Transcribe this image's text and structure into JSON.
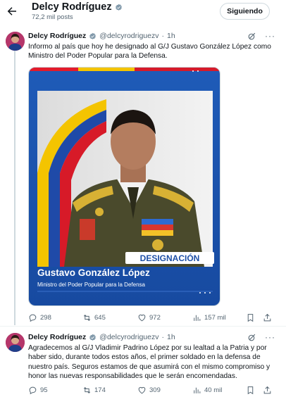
{
  "header": {
    "name": "Delcy Rodríguez",
    "posts": "72,2 mil posts",
    "follow_label": "Siguiendo"
  },
  "tweets": [
    {
      "name": "Delcy Rodríguez",
      "handle": "@delcyrodriguezv",
      "dot": "·",
      "time": "1h",
      "text": "Informo al país que hoy he designado al G/J Gustavo González López como Ministro del Poder Popular para la Defensa.",
      "media": {
        "badge": "DESIGNACIÓN",
        "person_name": "Gustavo González López",
        "person_title": "Ministro del Poder Popular para la Defensa"
      },
      "replies": "298",
      "reposts": "645",
      "likes": "972",
      "views": "157 mil"
    },
    {
      "name": "Delcy Rodríguez",
      "handle": "@delcyrodriguezv",
      "dot": "·",
      "time": "1h",
      "text": "Agradecemos al G/J Vladimir Padrino López por su lealtad a la Patria y por haber sido, durante todos estos años, el primer soldado en la defensa de nuestro país. Seguros estamos de que asumirá con el mismo compromiso y honor las nuevas responsabilidades que le serán encomendadas.",
      "replies": "95",
      "reposts": "174",
      "likes": "309",
      "views": "40 mil"
    }
  ],
  "colors": {
    "verified": "#829aab",
    "muted": "#536471",
    "media_blue": "#1f57b0",
    "badge_text": "#1d4fa6"
  }
}
